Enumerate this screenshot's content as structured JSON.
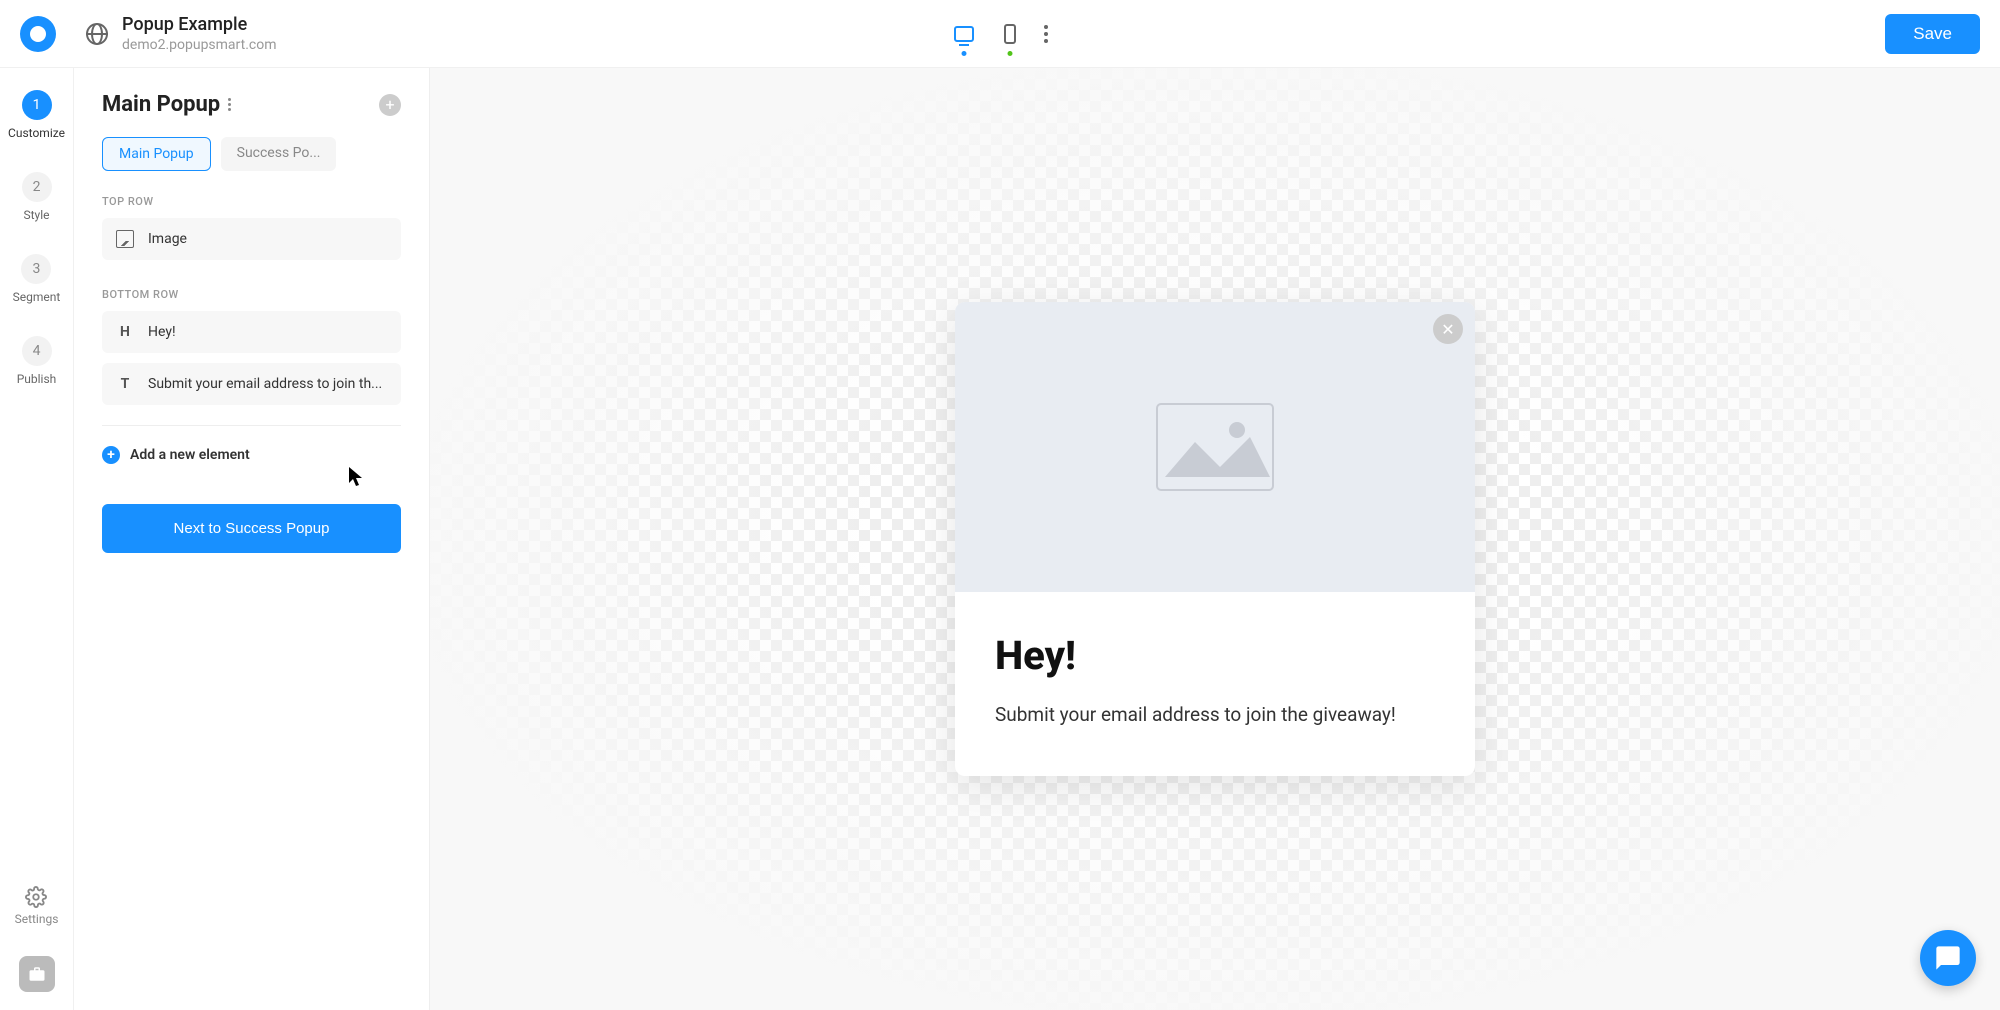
{
  "header": {
    "title": "Popup Example",
    "subtitle": "demo2.popupsmart.com",
    "save_label": "Save"
  },
  "steps": [
    {
      "num": "1",
      "label": "Customize"
    },
    {
      "num": "2",
      "label": "Style"
    },
    {
      "num": "3",
      "label": "Segment"
    },
    {
      "num": "4",
      "label": "Publish"
    }
  ],
  "settings_label": "Settings",
  "panel": {
    "title": "Main Popup",
    "tabs": [
      {
        "label": "Main Popup"
      },
      {
        "label": "Success Po..."
      }
    ],
    "section_top": "TOP ROW",
    "section_bottom": "BOTTOM ROW",
    "elements_top": [
      {
        "label": "Image",
        "icon": "image"
      }
    ],
    "elements_bottom": [
      {
        "label": "Hey!",
        "icon": "H"
      },
      {
        "label": "Submit your email address to join th...",
        "icon": "T"
      }
    ],
    "add_element_label": "Add a new element",
    "next_button": "Next to Success Popup"
  },
  "popup": {
    "heading": "Hey!",
    "text": "Submit your email address to join the giveaway!"
  }
}
